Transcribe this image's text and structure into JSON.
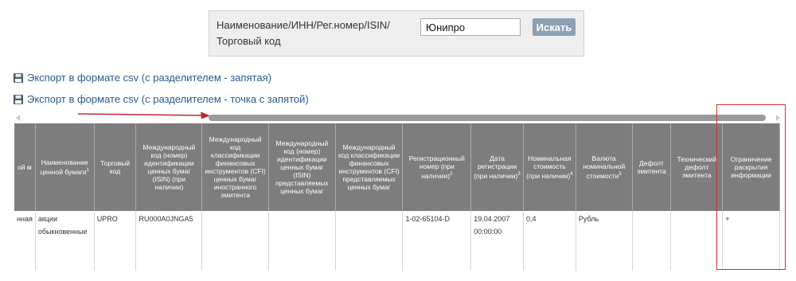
{
  "search": {
    "label": "Наименование/ИНН/Рег.номер/ISIN/ Торговый код",
    "value": "Юнипро",
    "button": "Искать"
  },
  "export_links": [
    {
      "label": "Экспорт в формате csv (с разделителем - запятая)",
      "icon": "floppy-disk-icon"
    },
    {
      "label": "Экспорт в формате csv (с разделителем - точка с запятой)",
      "icon": "floppy-disk-icon"
    }
  ],
  "colors": {
    "header_bg": "#7d7d7d",
    "link": "#2a5a8c",
    "button": "#8ba0b4",
    "highlight": "#d03030",
    "arrow": "#c0282d"
  },
  "table": {
    "columns": [
      {
        "label": "ой\nм"
      },
      {
        "label": "Наименование ценной бумаги",
        "note": "1"
      },
      {
        "label": "Торговый код"
      },
      {
        "label": "Международный код (номер) идентификации ценных бумаг (ISIN) (при наличии)"
      },
      {
        "label": "Международный код классификации финансовых инструментов (CFI) ценных бумаг иностранного эмитента"
      },
      {
        "label": "Международный код (номер) идентификации ценных бумаг (ISIN) представляемых ценных бумаг"
      },
      {
        "label": "Международный код классификации финансовых инструментов (CFI) представляемых ценных бумаг"
      },
      {
        "label": "Регистрационный номер (при наличии)",
        "note": "2"
      },
      {
        "label": "Дата регистрации (при наличии)",
        "note": "3"
      },
      {
        "label": "Номинальная стоимость (при наличии)",
        "note": "4"
      },
      {
        "label": "Валюта номинальной стоимости",
        "note": "5"
      },
      {
        "label": "Дефолт эмитента"
      },
      {
        "label": "Технический дефолт эмитента"
      },
      {
        "label": "Ограничение раскрытия информации"
      }
    ],
    "row": [
      "нная",
      "акции обыкновенные",
      "UPRO",
      "RU000A0JNGA5",
      "",
      "",
      "",
      "1-02-65104-D",
      "19.04.2007 00:00:00",
      "0,4",
      "Рубль",
      "",
      "",
      "+"
    ]
  }
}
